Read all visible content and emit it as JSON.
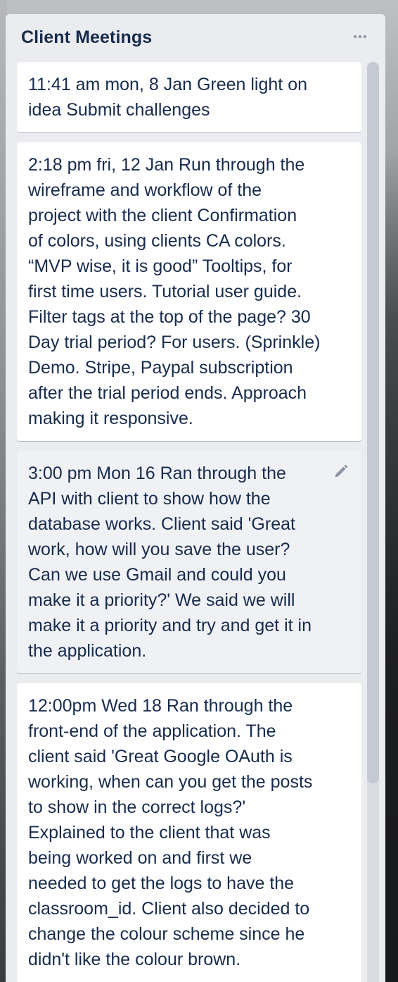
{
  "list": {
    "title": "Client Meetings",
    "menu_icon": "ellipsis-icon"
  },
  "cards": [
    {
      "text": "11:41 am mon, 8 Jan Green light on\nidea Submit challenges"
    },
    {
      "text": "2:18 pm fri, 12 Jan Run through the\nwireframe and workflow of the\nproject with the client Confirmation\nof colors, using clients CA colors.\n“MVP wise, it is good” Tooltips, for\nfirst time users. Tutorial user guide.\nFilter tags at the top of the page? 30\nDay trial period? For users. (Sprinkle)\nDemo. Stripe, Paypal subscription\nafter the trial period ends. Approach\nmaking it responsive."
    },
    {
      "text": "3:00 pm Mon 16 Ran through the\nAPI with client to show how the\ndatabase works. Client said 'Great\nwork, how will you save the user?\nCan we use Gmail and could you\nmake it a priority?' We said we will\nmake it a priority and try and get it in\nthe application.",
      "edit_icon": "pencil-icon"
    },
    {
      "text": "12:00pm Wed 18 Ran through the\nfront-end of the application. The\nclient said 'Great Google OAuth is\nworking, when can you get the posts\nto show in the correct logs?'\nExplained to the client that was\nbeing worked on and first we\nneeded to get the logs to have the\nclassroom_id. Client also decided to\nchange the colour scheme since he\ndidn't like the colour brown."
    }
  ],
  "colors": {
    "list_bg": "#ebecf0",
    "card_bg": "#ffffff",
    "card_hover_bg": "#f0f1f4",
    "text": "#172b4d",
    "icon": "#8c94a3"
  }
}
